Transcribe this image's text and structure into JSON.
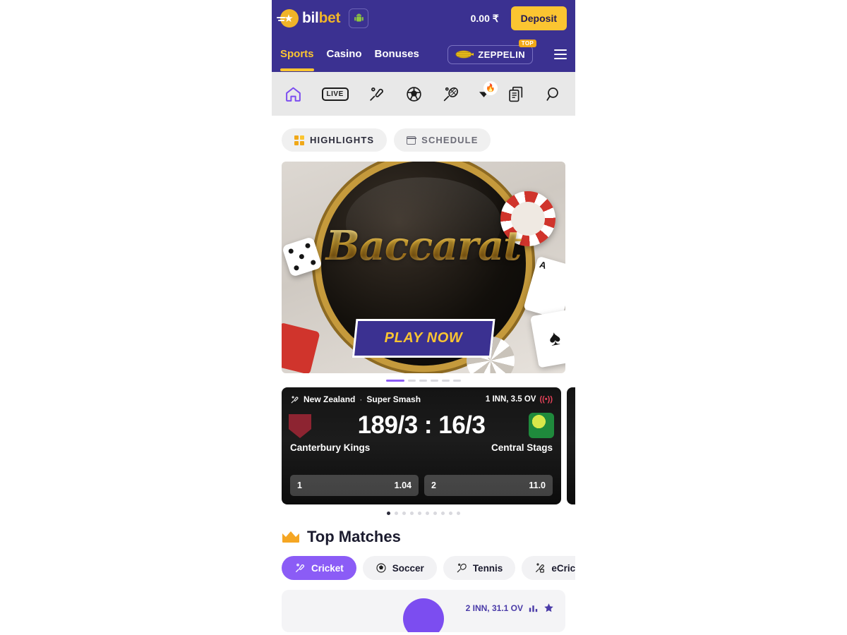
{
  "header": {
    "logo_text_white": "bil",
    "logo_text_gold": "bet",
    "logo_star_icon": "star-icon",
    "android_icon": "android-icon",
    "balance": "0.00 ₹",
    "deposit_label": "Deposit",
    "nav": [
      {
        "label": "Sports",
        "active": true
      },
      {
        "label": "Casino",
        "active": false
      },
      {
        "label": "Bonuses",
        "active": false
      }
    ],
    "zeppelin": {
      "label": "ZEPPELIN",
      "badge": "TOP",
      "icon": "zeppelin-icon"
    },
    "menu_icon": "hamburger-menu-icon",
    "brand_purple": "#3b3191",
    "brand_gold": "#fbc531"
  },
  "icon_nav": [
    {
      "name": "home-icon",
      "label": "Home",
      "active": true
    },
    {
      "name": "live-icon",
      "label": "LIVE",
      "active": false
    },
    {
      "name": "cricket-bat-icon",
      "label": "Cricket",
      "active": false
    },
    {
      "name": "soccer-ball-icon",
      "label": "Soccer",
      "active": false
    },
    {
      "name": "tennis-racket-icon",
      "label": "Tennis",
      "active": false
    },
    {
      "name": "chevron-down-icon",
      "label": "More",
      "badge": "flame-icon"
    },
    {
      "name": "bet-slip-icon",
      "label": "Bet slip",
      "active": false
    },
    {
      "name": "search-icon",
      "label": "Search",
      "active": false
    }
  ],
  "tabs": [
    {
      "label": "HIGHLIGHTS",
      "icon": "grid-icon",
      "active": true
    },
    {
      "label": "SCHEDULE",
      "icon": "calendar-icon",
      "active": false
    }
  ],
  "banner": {
    "title": "Baccarat",
    "cta_label": "PLAY NOW",
    "card_a_rank": "A",
    "card_b_suit": "♠",
    "pagination": {
      "total": 6,
      "active_index": 0
    }
  },
  "live_scores": {
    "pagination": {
      "total": 10,
      "active_index": 0
    },
    "cards": [
      {
        "sport_icon": "cricket-bat-icon",
        "country": "New Zealand",
        "separator": "·",
        "league": "Super Smash",
        "status": "1 INN, 3.5 OV",
        "live_icon": "live-signal-icon",
        "score": "189/3 : 16/3",
        "team_home": "Canterbury Kings",
        "team_away": "Central Stags",
        "odds": [
          {
            "label": "1",
            "value": "1.04"
          },
          {
            "label": "2",
            "value": "11.0"
          }
        ]
      }
    ]
  },
  "top_matches": {
    "crown_icon": "crown-icon",
    "title": "Top Matches",
    "chips": [
      {
        "label": "Cricket",
        "icon": "cricket-bat-icon",
        "active": true
      },
      {
        "label": "Soccer",
        "icon": "soccer-ball-icon",
        "active": false
      },
      {
        "label": "Tennis",
        "icon": "tennis-racket-icon",
        "active": false
      },
      {
        "label": "eCricket",
        "icon": "ecricket-icon",
        "active": false
      }
    ],
    "first_row": {
      "status": "2 INN, 31.1 OV",
      "stats_icon": "bar-chart-icon",
      "favourite_icon": "star-icon"
    }
  }
}
